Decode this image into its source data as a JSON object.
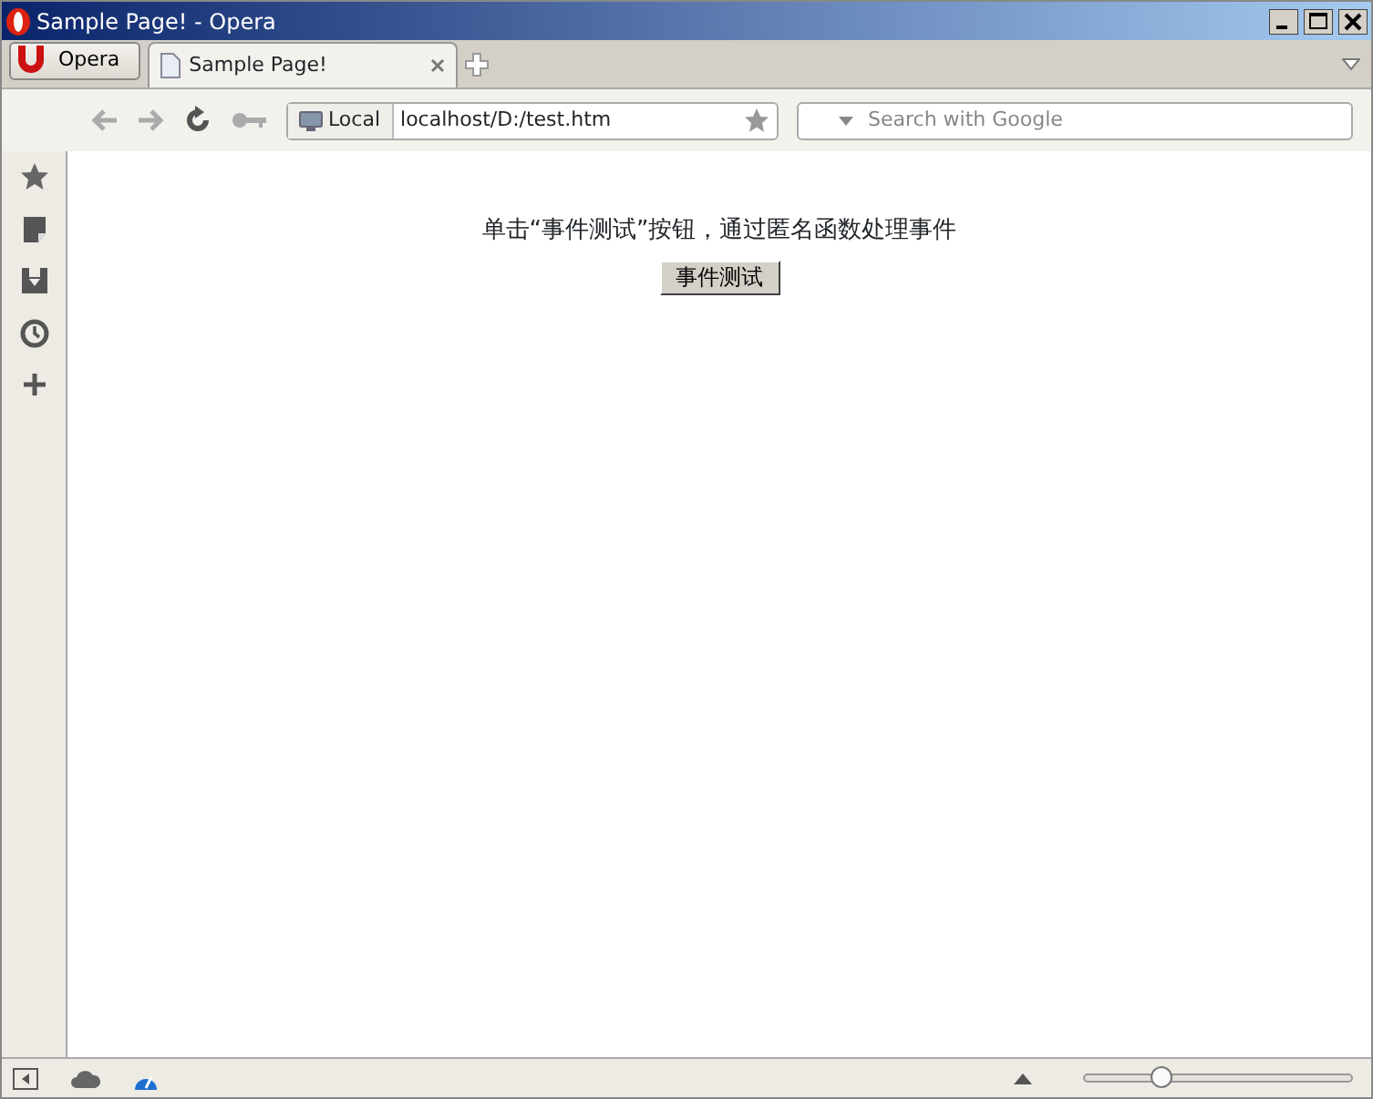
{
  "window": {
    "title": "Sample Page! - Opera"
  },
  "menu_button": {
    "label": "Opera"
  },
  "tabs": [
    {
      "label": "Sample Page!",
      "selected": true
    }
  ],
  "address_bar": {
    "badge": "Local",
    "value": "localhost/D:/test.htm"
  },
  "search": {
    "placeholder": "Search with Google"
  },
  "page": {
    "text": "单击“事件测试”按钮，通过匿名函数处理事件",
    "button": "事件测试"
  },
  "zoom": {
    "level": 0.29
  }
}
